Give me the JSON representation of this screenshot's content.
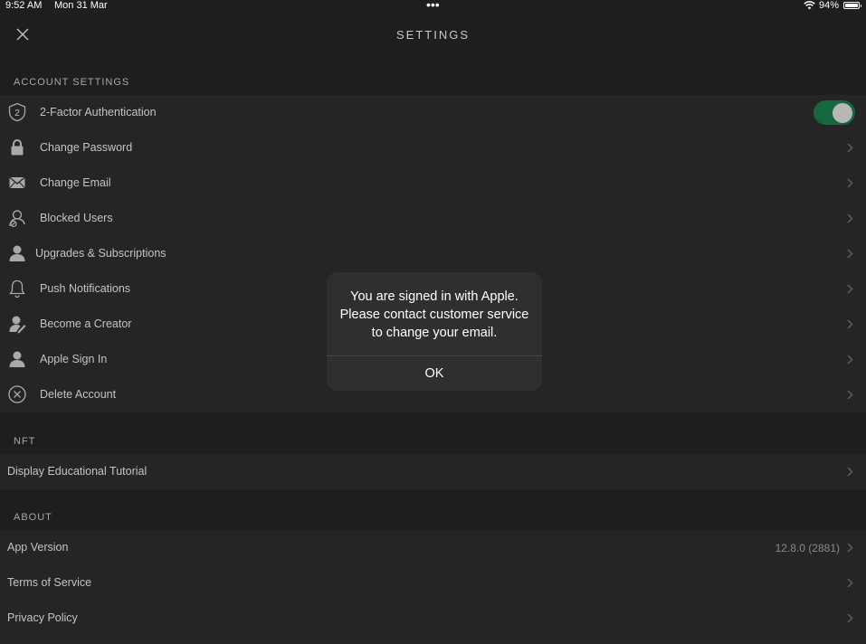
{
  "status_bar": {
    "time": "9:52 AM",
    "date": "Mon 31 Mar",
    "dots": "•••",
    "battery": "94%"
  },
  "header": {
    "title": "SETTINGS",
    "close_icon": "close-icon"
  },
  "account": {
    "header": "ACCOUNT SETTINGS",
    "items": [
      {
        "label": "2-Factor Authentication",
        "icon": "two-factor-shield-icon",
        "toggle": true
      },
      {
        "label": "Change Password",
        "icon": "lock-icon"
      },
      {
        "label": "Change Email",
        "icon": "envelope-icon"
      },
      {
        "label": "Blocked Users",
        "icon": "blocked-user-icon"
      },
      {
        "label": "Upgrades & Subscriptions",
        "icon": "user-icon"
      },
      {
        "label": "Push Notifications",
        "icon": "bell-icon"
      },
      {
        "label": "Become a Creator",
        "icon": "creator-icon"
      },
      {
        "label": "Apple Sign In",
        "icon": "user-icon"
      },
      {
        "label": "Delete Account",
        "icon": "delete-circle-icon"
      }
    ]
  },
  "nft": {
    "header": "NFT",
    "items": [
      {
        "label": "Display Educational Tutorial"
      }
    ]
  },
  "about": {
    "header": "ABOUT",
    "items": [
      {
        "label": "App Version",
        "value": "12.8.0 (2881)"
      },
      {
        "label": "Terms of Service"
      },
      {
        "label": "Privacy Policy"
      }
    ]
  },
  "alert": {
    "message": "You are signed in with Apple. Please contact customer service to change your email.",
    "ok": "OK"
  },
  "colors": {
    "background": "#1e1e1e",
    "row": "#252525",
    "toggle_on": "#14673f",
    "alert_bg": "#2f2f31"
  }
}
